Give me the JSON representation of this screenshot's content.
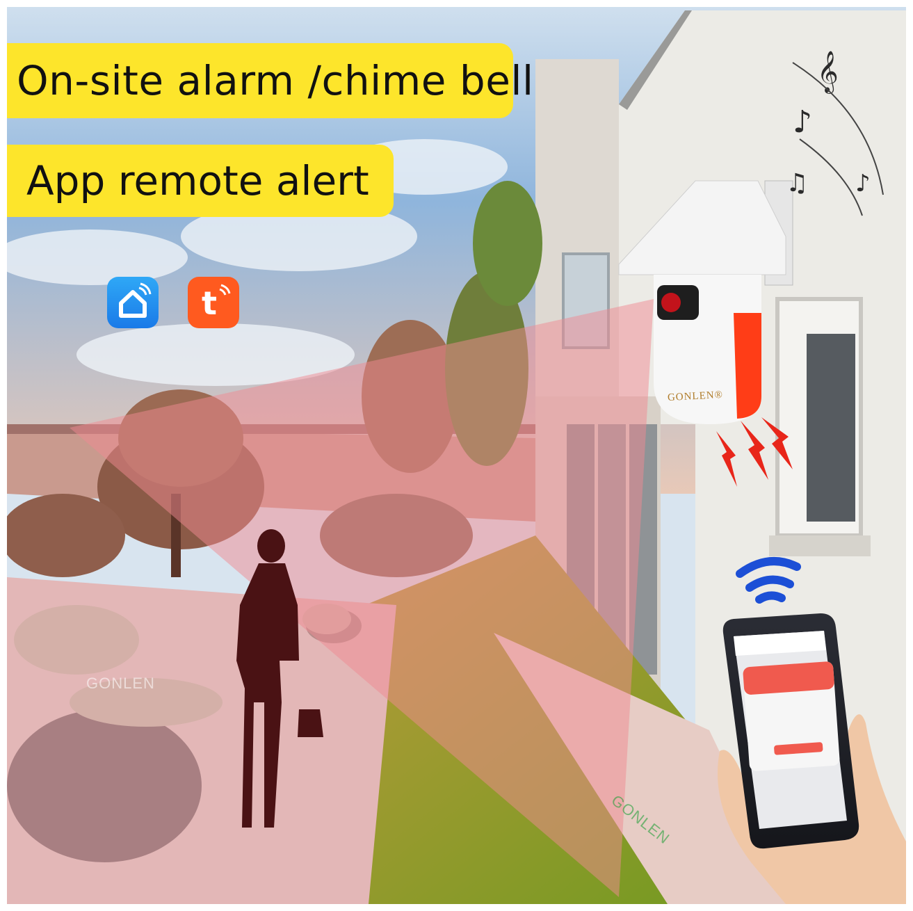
{
  "banners": {
    "headline": "On-site alarm /chime bell",
    "subheadline": "App remote alert"
  },
  "apps": [
    {
      "name": "smart-life-app-icon",
      "color": "#1f8ff0"
    },
    {
      "name": "tuya-app-icon",
      "color": "#ff5a1f"
    }
  ],
  "device": {
    "brand": "GONLEN®",
    "accent_color": "#ff3d17"
  },
  "watermarks": [
    "GONLEN",
    "GONLEN"
  ],
  "colors": {
    "banner_yellow": "#fde52b",
    "detection_zone": "#f08a92",
    "alarm_red": "#e8261a"
  }
}
